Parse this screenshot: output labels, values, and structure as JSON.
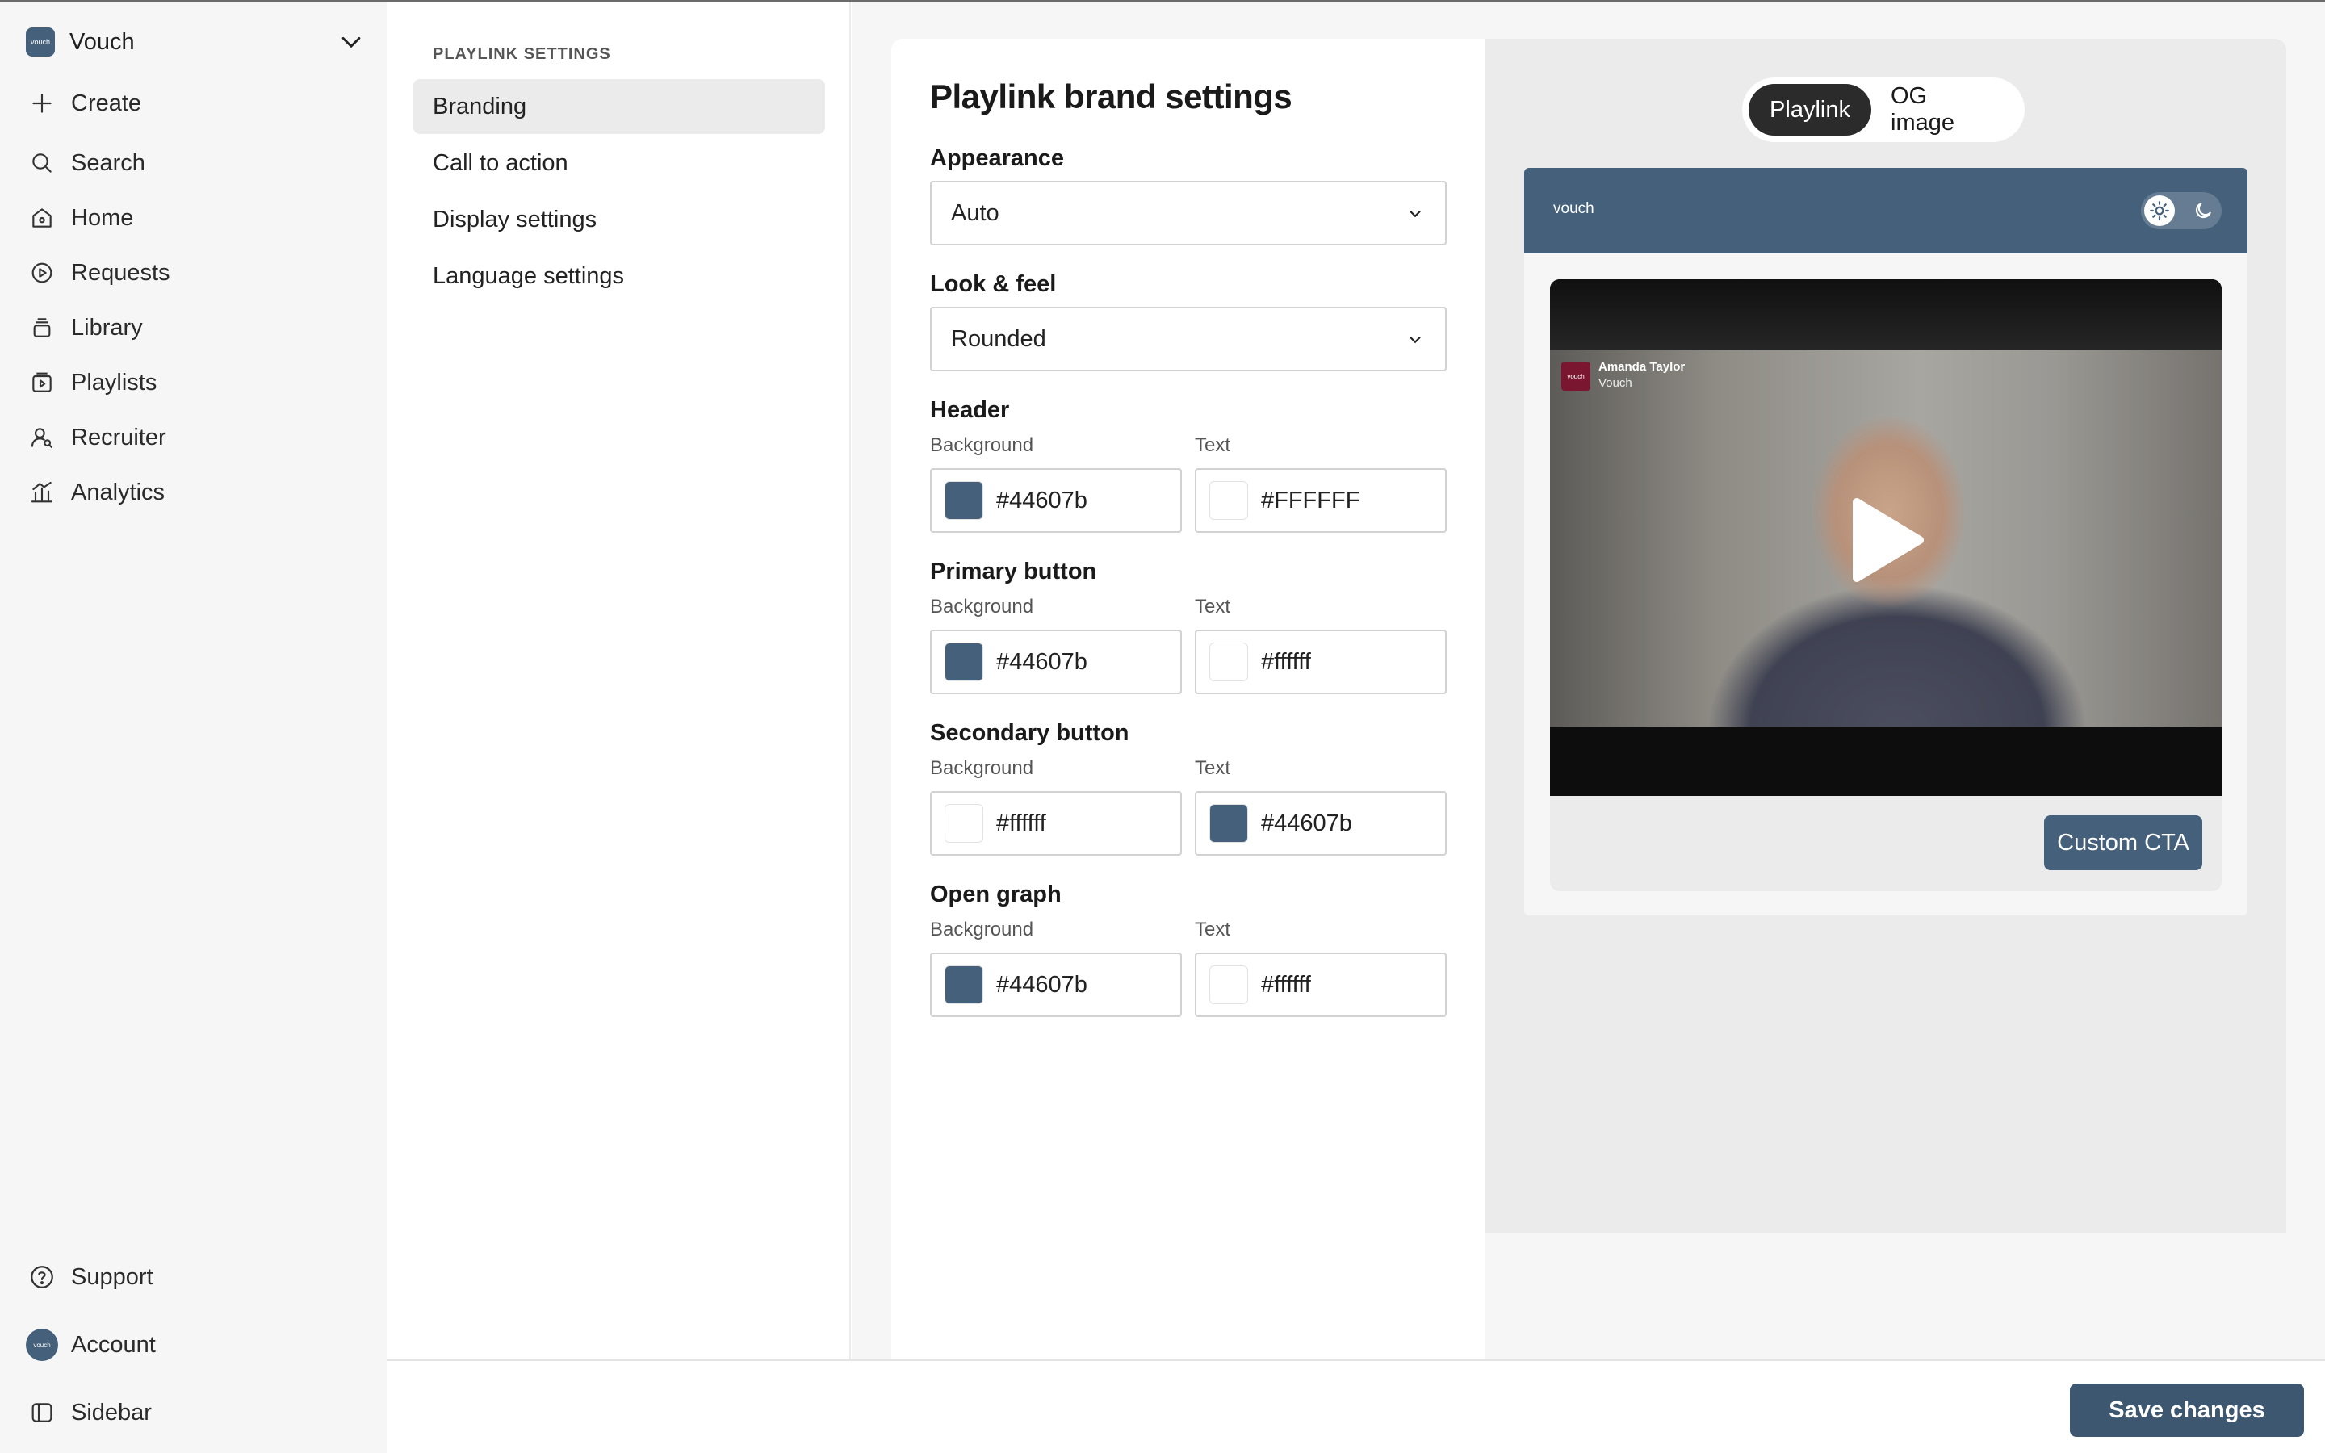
{
  "workspace": {
    "logo_text": "vouch",
    "name": "Vouch"
  },
  "nav": {
    "create": "Create",
    "search": "Search",
    "home": "Home",
    "requests": "Requests",
    "library": "Library",
    "playlists": "Playlists",
    "recruiter": "Recruiter",
    "analytics": "Analytics",
    "support": "Support",
    "account": "Account",
    "account_avatar": "vouch",
    "sidebar": "Sidebar"
  },
  "submenu": {
    "title": "PLAYLINK SETTINGS",
    "items": [
      {
        "label": "Branding",
        "active": true
      },
      {
        "label": "Call to action",
        "active": false
      },
      {
        "label": "Display settings",
        "active": false
      },
      {
        "label": "Language settings",
        "active": false
      }
    ]
  },
  "form": {
    "title": "Playlink brand settings",
    "appearance": {
      "label": "Appearance",
      "value": "Auto"
    },
    "look_feel": {
      "label": "Look & feel",
      "value": "Rounded"
    },
    "sections": [
      {
        "label": "Header",
        "bg_label": "Background",
        "text_label": "Text",
        "bg": "#44607b",
        "text": "#FFFFFF"
      },
      {
        "label": "Primary button",
        "bg_label": "Background",
        "text_label": "Text",
        "bg": "#44607b",
        "text": "#ffffff"
      },
      {
        "label": "Secondary button",
        "bg_label": "Background",
        "text_label": "Text",
        "bg": "#ffffff",
        "text": "#44607b"
      },
      {
        "label": "Open graph",
        "bg_label": "Background",
        "text_label": "Text",
        "bg": "#44607b",
        "text": "#ffffff"
      }
    ]
  },
  "preview": {
    "tabs": [
      {
        "label": "Playlink",
        "active": true
      },
      {
        "label": "OG image",
        "active": false
      }
    ],
    "brand": "vouch",
    "video_badge": "vouch",
    "video_person": "Amanda Taylor",
    "video_company": "Vouch",
    "cta_label": "Custom CTA"
  },
  "footer": {
    "save_label": "Save changes"
  },
  "colors": {
    "brand": "#44607b",
    "save": "#3d5771"
  },
  "icons": [
    "chevron-down-icon",
    "plus-icon",
    "search-icon",
    "home-icon",
    "requests-icon",
    "library-icon",
    "playlists-icon",
    "recruiter-icon",
    "analytics-icon",
    "support-icon",
    "sidebar-icon",
    "sun-icon",
    "moon-icon",
    "play-icon"
  ]
}
